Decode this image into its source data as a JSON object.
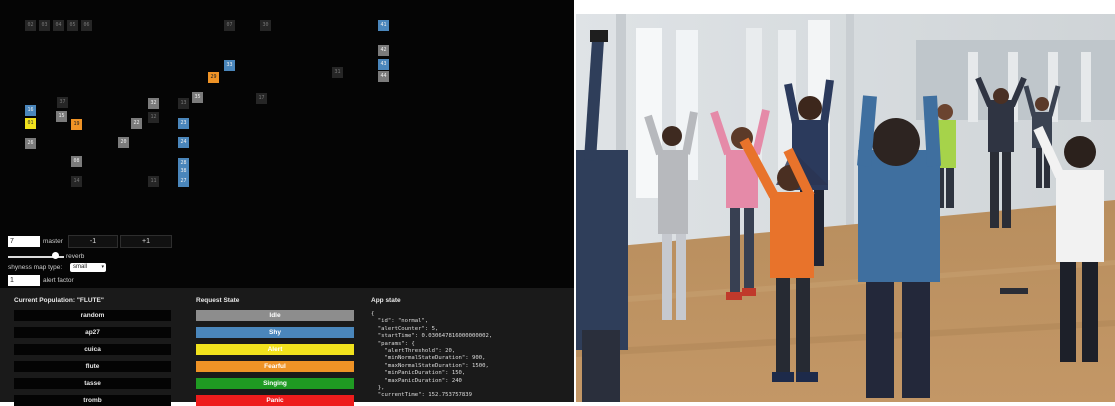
{
  "shyness_map": {
    "squares": [
      {
        "label": "02",
        "color": "dark"
      },
      {
        "label": "03",
        "color": "dark"
      },
      {
        "label": "04",
        "color": "dark"
      },
      {
        "label": "05",
        "color": "dark"
      },
      {
        "label": "06",
        "color": "dark"
      },
      {
        "label": "41",
        "color": "blue"
      },
      {
        "label": "42",
        "color": "gray"
      },
      {
        "label": "43",
        "color": "blue"
      },
      {
        "label": "44",
        "color": "gray"
      },
      {
        "label": "33",
        "color": "blue"
      },
      {
        "label": "29",
        "color": "orange"
      },
      {
        "label": "31",
        "color": "dark"
      },
      {
        "label": "35",
        "color": "gray"
      },
      {
        "label": "17",
        "color": "dark"
      },
      {
        "label": "32",
        "color": "gray"
      },
      {
        "label": "37",
        "color": "dark"
      },
      {
        "label": "16",
        "color": "blue"
      },
      {
        "label": "12",
        "color": "dark"
      },
      {
        "label": "13",
        "color": "dark"
      },
      {
        "label": "15",
        "color": "gray"
      },
      {
        "label": "22",
        "color": "gray"
      },
      {
        "label": "23",
        "color": "blue"
      },
      {
        "label": "01",
        "color": "yellow"
      },
      {
        "label": "19",
        "color": "orange"
      },
      {
        "label": "26",
        "color": "gray"
      },
      {
        "label": "20",
        "color": "gray"
      },
      {
        "label": "24",
        "color": "blue"
      },
      {
        "label": "08",
        "color": "gray"
      },
      {
        "label": "14",
        "color": "dark"
      },
      {
        "label": "28",
        "color": "blue"
      },
      {
        "label": "11",
        "color": "dark"
      },
      {
        "label": "38",
        "color": "blue"
      },
      {
        "label": "27",
        "color": "blue"
      },
      {
        "label": "07",
        "color": "dark"
      },
      {
        "label": "30",
        "color": "dark"
      }
    ]
  },
  "controls": {
    "master_value": "7",
    "master_label": "master",
    "minus_label": "-1",
    "plus_label": "+1",
    "reverb_label": "reverb",
    "reverb_level": 0.85,
    "shyness_map_type_label": "shyness map type:",
    "shyness_map_type_value": "small",
    "alert_factor_value": "1",
    "alert_factor_label": "alert factor"
  },
  "population": {
    "title": "Current Population: \"FLUTE\"",
    "items": [
      "random",
      "ap27",
      "cuica",
      "flute",
      "tasse",
      "tromb"
    ]
  },
  "request_state": {
    "title": "Request State",
    "states": [
      {
        "label": "Idle",
        "color": "#8d8d8d"
      },
      {
        "label": "Shy",
        "color": "#4a86bb"
      },
      {
        "label": "Alert",
        "color": "#f1e21d"
      },
      {
        "label": "Fearful",
        "color": "#ef9326"
      },
      {
        "label": "Singing",
        "color": "#1f9a22"
      },
      {
        "label": "Panic",
        "color": "#ee1c1c"
      }
    ]
  },
  "app_state": {
    "title": "App state",
    "json": "{\n  \"id\": \"normal\",\n  \"alertCounter\": 5,\n  \"startTime\": 0.030647816000000002,\n  \"params\": {\n    \"alertThreshold\": 20,\n    \"minNormalStateDuration\": 900,\n    \"maxNormalStateDuration\": 1500,\n    \"minPanicDuration\": 150,\n    \"maxPanicDuration\": 240\n  },\n  \"currentTime\": 152.753757839"
  }
}
